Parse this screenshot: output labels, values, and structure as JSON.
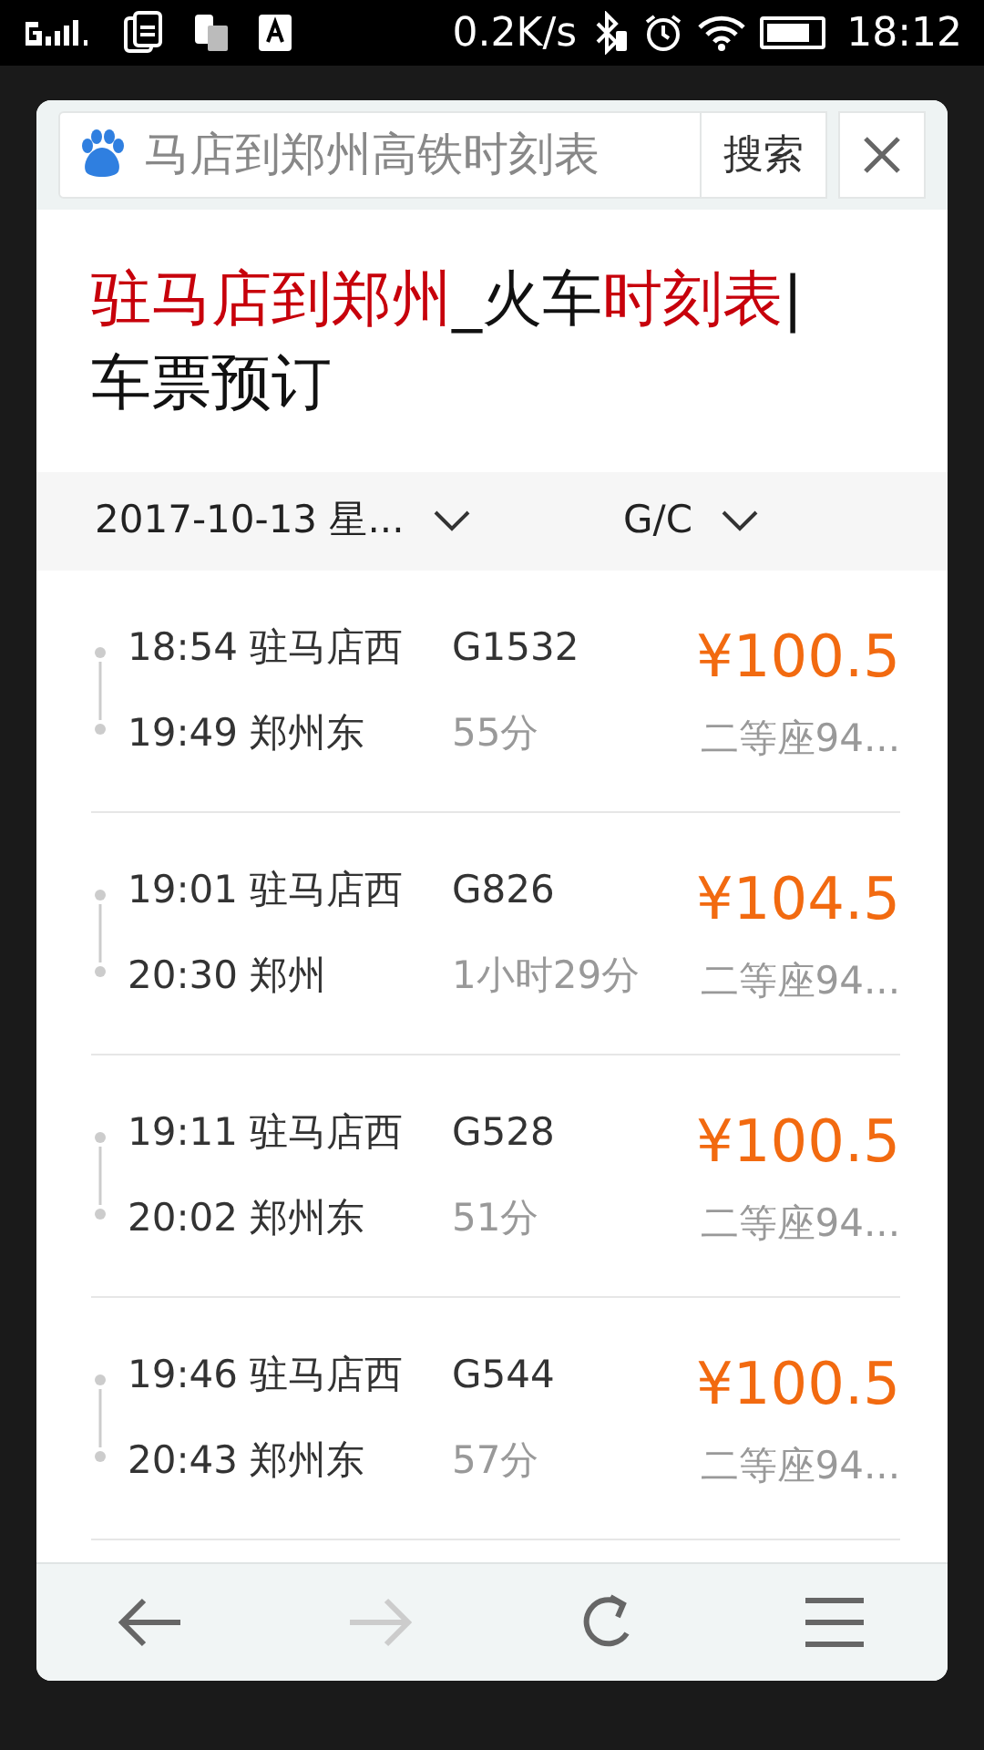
{
  "status_bar": {
    "speed": "0.2K/s",
    "time": "18:12"
  },
  "search": {
    "value": "马店到郑州高铁时刻表",
    "button": "搜索"
  },
  "title": [
    {
      "text": "驻马店到郑州",
      "highlight": true
    },
    {
      "text": "_火车",
      "highlight": false
    },
    {
      "text": "时刻表",
      "highlight": true
    },
    {
      "text": "|车票预订",
      "highlight": false
    }
  ],
  "filters": [
    {
      "label": "2017-10-13 星..."
    },
    {
      "label": "G/C"
    }
  ],
  "trains": [
    {
      "depart": "18:54 驻马店西",
      "arrive": "19:49 郑州东",
      "number": "G1532",
      "duration": "55分",
      "price": "¥100.5",
      "seat": "二等座94..."
    },
    {
      "depart": "19:01 驻马店西",
      "arrive": "20:30 郑州",
      "number": "G826",
      "duration": "1小时29分",
      "price": "¥104.5",
      "seat": "二等座94..."
    },
    {
      "depart": "19:11 驻马店西",
      "arrive": "20:02 郑州东",
      "number": "G528",
      "duration": "51分",
      "price": "¥100.5",
      "seat": "二等座94..."
    },
    {
      "depart": "19:46 驻马店西",
      "arrive": "20:43 郑州东",
      "number": "G544",
      "duration": "57分",
      "price": "¥100.5",
      "seat": "二等座94..."
    }
  ],
  "nav": [
    {
      "kind": "back",
      "disabled": false
    },
    {
      "kind": "forward",
      "disabled": true
    },
    {
      "kind": "reload",
      "disabled": false
    },
    {
      "kind": "menu",
      "disabled": false
    }
  ]
}
